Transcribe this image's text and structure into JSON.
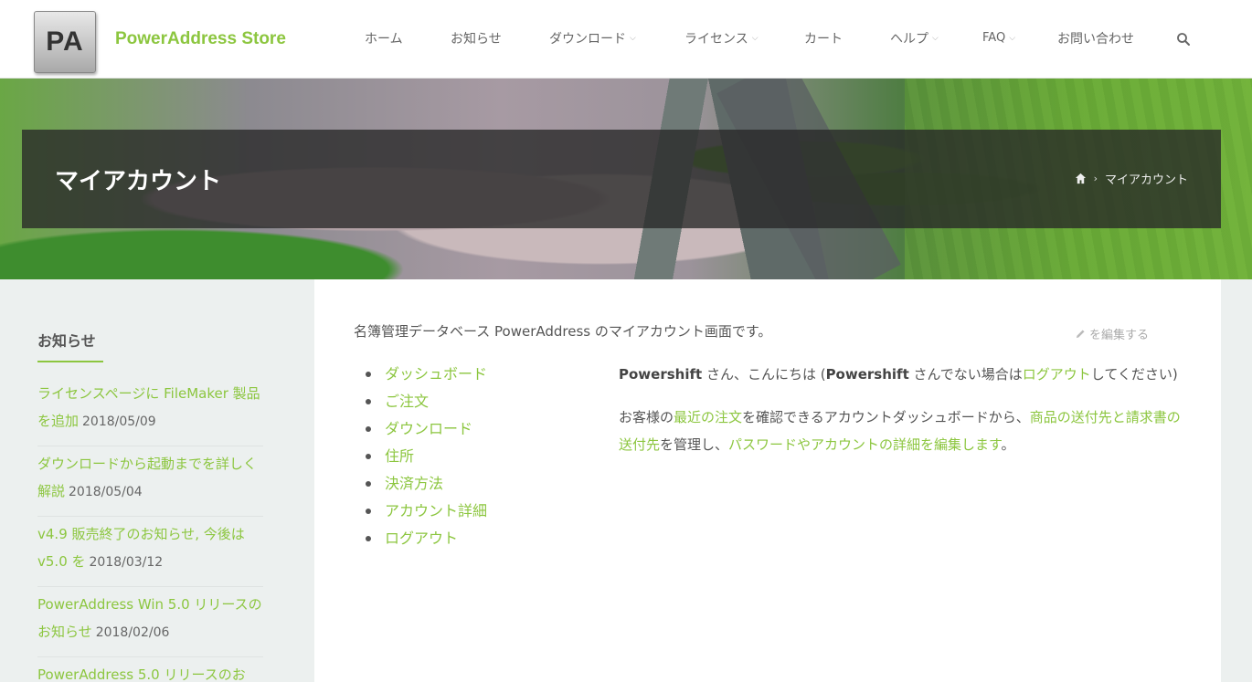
{
  "header": {
    "logo_text": "PA",
    "site_name": "PowerAddress Store",
    "nav": [
      {
        "label": "ホーム",
        "has_dropdown": false
      },
      {
        "label": "お知らせ",
        "has_dropdown": false
      },
      {
        "label": "ダウンロード",
        "has_dropdown": true
      },
      {
        "label": "ライセンス",
        "has_dropdown": true
      },
      {
        "label": "カート",
        "has_dropdown": false
      },
      {
        "label": "ヘルプ",
        "has_dropdown": true
      },
      {
        "label": "FAQ",
        "has_dropdown": true
      },
      {
        "label": "お問い合わせ",
        "has_dropdown": false
      }
    ],
    "search_icon": "search-icon"
  },
  "hero": {
    "title": "マイアカウント",
    "breadcrumb": {
      "home_icon": "home-icon",
      "separator": "›",
      "current": "マイアカウント"
    }
  },
  "sidebar": {
    "widget_title": "お知らせ",
    "news": [
      {
        "title": "ライセンスページに FileMaker 製品を追加",
        "date": "2018/05/09"
      },
      {
        "title": "ダウンロードから起動までを詳しく解説",
        "date": "2018/05/04"
      },
      {
        "title": "v4.9 販売終了のお知らせ, 今後は v5.0 を",
        "date": "2018/03/12"
      },
      {
        "title": "PowerAddress Win 5.0 リリースのお知らせ",
        "date": "2018/02/06"
      },
      {
        "title": "PowerAddress 5.0 リリースのお",
        "date": ""
      }
    ]
  },
  "content": {
    "intro": "名簿管理データベース PowerAddress のマイアカウント画面です。",
    "edit_label": "を編集する",
    "account_nav": [
      "ダッシュボード",
      "ご注文",
      "ダウンロード",
      "住所",
      "決済方法",
      "アカウント詳細",
      "ログアウト"
    ],
    "greeting": {
      "user": "Powershift",
      "t1": " さん、こんにちは (",
      "user2": "Powershift",
      "t2": " さんでない場合は",
      "logout_link": "ログアウト",
      "t3": "してください)"
    },
    "dashboard_text": {
      "t1": "お客様の",
      "link_orders": "最近の注文",
      "t2": "を確認できるアカウントダッシュボードから、",
      "link_addresses": "商品の送付先と請求書の送付先",
      "t3": "を管理し、",
      "link_account": "パスワードやアカウントの詳細を編集します",
      "t4": "。"
    }
  },
  "colors": {
    "accent": "#8cc63f",
    "text": "#555555",
    "sidebar_bg": "#ecf0ef"
  }
}
